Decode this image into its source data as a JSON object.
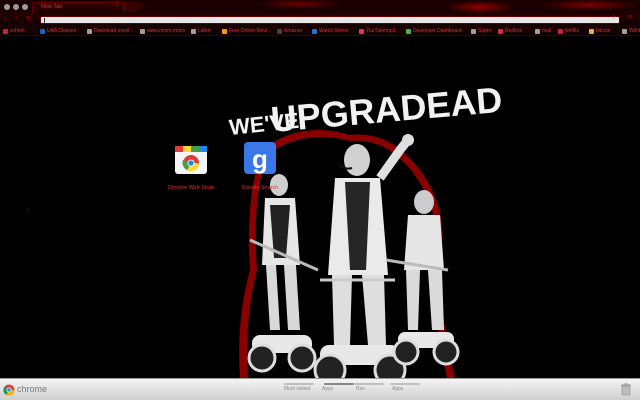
{
  "window": {
    "tab_title": "New Tab",
    "tab_close": "×"
  },
  "toolbar": {
    "back_icon": "‹",
    "forward_icon": "›",
    "reload_icon": "↻",
    "star_icon": "☆",
    "menu_icon": "≡"
  },
  "bookmarks": [
    {
      "label": "school",
      "color": "#c62828"
    },
    {
      "label": "UAA Classes",
      "color": "#1565c0"
    },
    {
      "label": "Download excel ...",
      "color": "#9e9e9e"
    },
    {
      "label": "www.mmm.mmm",
      "color": "#9e9e9e"
    },
    {
      "label": "Lsbrrr",
      "color": "#9e9e9e"
    },
    {
      "label": "Free Online Movi...",
      "color": "#ff9800"
    },
    {
      "label": "Amazon",
      "color": "#424242"
    },
    {
      "label": "Watch Series",
      "color": "#1976d2"
    },
    {
      "label": "YouTubemp3",
      "color": "#e53935"
    },
    {
      "label": "Developer Dashboard",
      "color": "#4caf50"
    },
    {
      "label": "Super",
      "color": "#9e9e9e"
    },
    {
      "label": "Redbox",
      "color": "#d32f2f"
    },
    {
      "label": "mail",
      "color": "#9e9e9e"
    },
    {
      "label": "Netflix",
      "color": "#c62828"
    },
    {
      "label": "bitcoin",
      "color": "#f9a825"
    },
    {
      "label": "Wimbleg",
      "color": "#9e9e9e"
    },
    {
      "label": "ru sites",
      "color": "#9e9e9e"
    }
  ],
  "ntp": {
    "left_arrow": "‹",
    "apps": [
      {
        "label": "Chrome Web Store"
      },
      {
        "label": "Google Search"
      }
    ],
    "headline_1": "WE'VE",
    "headline_2": "UPGRADEAD"
  },
  "bottom": {
    "brand": "chrome",
    "sections": [
      "Most visited",
      "Apps",
      "Rss",
      "Apps"
    ]
  },
  "colors": {
    "accent": "#e03030",
    "blood": "#8a0000",
    "background": "#000000"
  }
}
